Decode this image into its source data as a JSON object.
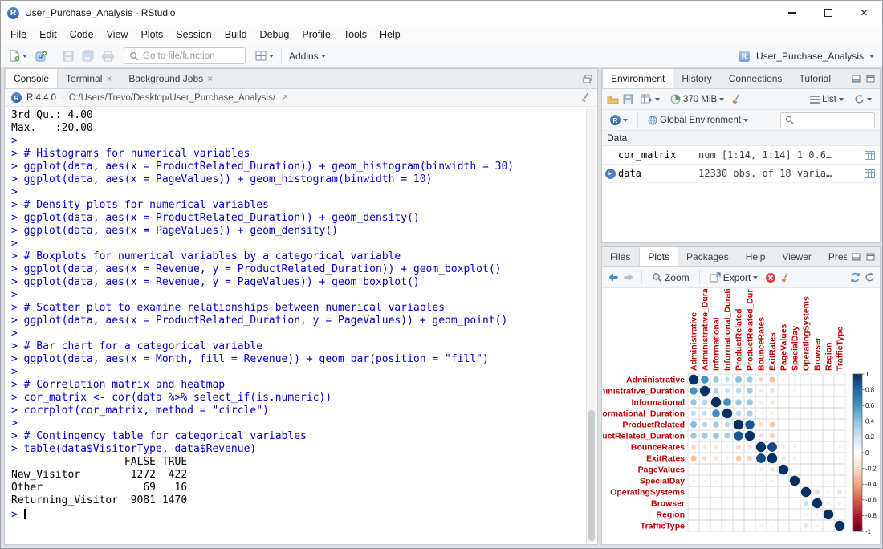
{
  "window": {
    "title": "User_Purchase_Analysis - RStudio"
  },
  "menubar": {
    "items": [
      "File",
      "Edit",
      "Code",
      "View",
      "Plots",
      "Session",
      "Build",
      "Debug",
      "Profile",
      "Tools",
      "Help"
    ]
  },
  "toolbar": {
    "goto_placeholder": "Go to file/function",
    "addins_label": "Addins",
    "project_label": "User_Purchase_Analysis"
  },
  "console": {
    "tabs": [
      {
        "label": "Console",
        "active": true,
        "closable": false
      },
      {
        "label": "Terminal",
        "active": false,
        "closable": true
      },
      {
        "label": "Background Jobs",
        "active": false,
        "closable": true
      }
    ],
    "r_version": "R 4.4.0",
    "separator": "·",
    "working_dir": "C:/Users/Trevo/Desktop/User_Purchase_Analysis/",
    "lines": [
      {
        "t": "3rd Qu.: 4.00",
        "k": "out"
      },
      {
        "t": "Max.   :20.00",
        "k": "out"
      },
      {
        "t": "> ",
        "k": "in"
      },
      {
        "t": "> # Histograms for numerical variables",
        "k": "in"
      },
      {
        "t": "> ggplot(data, aes(x = ProductRelated_Duration)) + geom_histogram(binwidth = 30)",
        "k": "in"
      },
      {
        "t": "> ggplot(data, aes(x = PageValues)) + geom_histogram(binwidth = 10)",
        "k": "in"
      },
      {
        "t": "> ",
        "k": "in"
      },
      {
        "t": "> # Density plots for numerical variables",
        "k": "in"
      },
      {
        "t": "> ggplot(data, aes(x = ProductRelated_Duration)) + geom_density()",
        "k": "in"
      },
      {
        "t": "> ggplot(data, aes(x = PageValues)) + geom_density()",
        "k": "in"
      },
      {
        "t": "> ",
        "k": "in"
      },
      {
        "t": "> # Boxplots for numerical variables by a categorical variable",
        "k": "in"
      },
      {
        "t": "> ggplot(data, aes(x = Revenue, y = ProductRelated_Duration)) + geom_boxplot()",
        "k": "in"
      },
      {
        "t": "> ggplot(data, aes(x = Revenue, y = PageValues)) + geom_boxplot()",
        "k": "in"
      },
      {
        "t": "> ",
        "k": "in"
      },
      {
        "t": "> # Scatter plot to examine relationships between numerical variables",
        "k": "in"
      },
      {
        "t": "> ggplot(data, aes(x = ProductRelated_Duration, y = PageValues)) + geom_point()",
        "k": "in"
      },
      {
        "t": "> ",
        "k": "in"
      },
      {
        "t": "> # Bar chart for a categorical variable",
        "k": "in"
      },
      {
        "t": "> ggplot(data, aes(x = Month, fill = Revenue)) + geom_bar(position = \"fill\")",
        "k": "in"
      },
      {
        "t": "> ",
        "k": "in"
      },
      {
        "t": "> # Correlation matrix and heatmap",
        "k": "in"
      },
      {
        "t": "> cor_matrix <- cor(data %>% select_if(is.numeric))",
        "k": "in"
      },
      {
        "t": "> corrplot(cor_matrix, method = \"circle\")",
        "k": "in"
      },
      {
        "t": "> ",
        "k": "in"
      },
      {
        "t": "> # Contingency table for categorical variables",
        "k": "in"
      },
      {
        "t": "> table(data$VisitorType, data$Revenue)",
        "k": "in"
      },
      {
        "t": "",
        "k": "out"
      },
      {
        "t": "                  FALSE TRUE",
        "k": "out"
      },
      {
        "t": "New_Visitor        1272  422",
        "k": "out"
      },
      {
        "t": "Other                69   16",
        "k": "out"
      },
      {
        "t": "Returning_Visitor  9081 1470",
        "k": "out"
      },
      {
        "t": "> ",
        "k": "in",
        "cursor": true
      }
    ]
  },
  "environment": {
    "tabs": [
      "Environment",
      "History",
      "Connections",
      "Tutorial"
    ],
    "active_tab": "Environment",
    "memory_label": "370 MiB",
    "language_label": "R",
    "scope_label": "Global Environment",
    "list_label": "List",
    "section_label": "Data",
    "objects": [
      {
        "name": "cor_matrix",
        "value": "num [1:14, 1:14] 1 0.6…",
        "expandable": false
      },
      {
        "name": "data",
        "value": "12330 obs. of 18 varia…",
        "expandable": true
      }
    ]
  },
  "plots": {
    "tabs": [
      "Files",
      "Plots",
      "Packages",
      "Help",
      "Viewer",
      "Prese"
    ],
    "active_tab": "Plots",
    "zoom_label": "Zoom",
    "export_label": "Export"
  },
  "chart_data": {
    "type": "heatmap",
    "subtype": "correlation-circle-matrix",
    "title": "corrplot(cor_matrix, method = \"circle\")",
    "variables": [
      "Administrative",
      "Administrative_Duration",
      "Informational",
      "Informational_Duration",
      "ProductRelated",
      "ProductRelated_Duration",
      "BounceRates",
      "ExitRates",
      "PageValues",
      "SpecialDay",
      "OperatingSystems",
      "Browser",
      "Region",
      "TrafficType"
    ],
    "matrix": [
      [
        1,
        0.6,
        0.38,
        0.26,
        0.43,
        0.37,
        -0.22,
        -0.32,
        0.1,
        -0.09,
        -0.01,
        -0.03,
        -0.01,
        -0.03
      ],
      [
        0.6,
        1,
        0.3,
        0.24,
        0.29,
        0.36,
        -0.14,
        -0.21,
        0.07,
        -0.07,
        0,
        -0.02,
        0,
        -0.01
      ],
      [
        0.38,
        0.3,
        1,
        0.62,
        0.37,
        0.39,
        -0.12,
        -0.16,
        0.05,
        -0.05,
        -0.01,
        -0.04,
        -0.03,
        -0.03
      ],
      [
        0.26,
        0.24,
        0.62,
        1,
        0.28,
        0.35,
        -0.07,
        -0.11,
        0.03,
        -0.03,
        -0.01,
        -0.02,
        -0.03,
        -0.02
      ],
      [
        0.43,
        0.29,
        0.37,
        0.28,
        1,
        0.86,
        -0.2,
        -0.29,
        0.06,
        -0.02,
        0,
        -0.01,
        -0.04,
        -0.04
      ],
      [
        0.37,
        0.36,
        0.39,
        0.35,
        0.86,
        1,
        -0.18,
        -0.25,
        0.05,
        -0.04,
        0,
        0,
        -0.03,
        -0.04
      ],
      [
        -0.22,
        -0.14,
        -0.12,
        -0.07,
        -0.2,
        -0.18,
        1,
        0.91,
        -0.12,
        0.07,
        0.02,
        -0.02,
        -0.01,
        0.08
      ],
      [
        -0.32,
        -0.21,
        -0.16,
        -0.11,
        -0.29,
        -0.25,
        0.91,
        1,
        -0.17,
        0.1,
        0.02,
        -0.01,
        0,
        0.08
      ],
      [
        0.1,
        0.07,
        0.05,
        0.03,
        0.06,
        0.05,
        -0.12,
        -0.17,
        1,
        -0.06,
        0.02,
        0.05,
        0.01,
        0.01
      ],
      [
        -0.09,
        -0.07,
        -0.05,
        -0.03,
        -0.02,
        -0.04,
        0.07,
        0.1,
        -0.06,
        1,
        0.01,
        0,
        -0.02,
        0.05
      ],
      [
        -0.01,
        0,
        -0.01,
        -0.01,
        0,
        0,
        0.02,
        0.02,
        0.02,
        0.01,
        1,
        0.22,
        0.08,
        0.19
      ],
      [
        -0.03,
        -0.02,
        -0.04,
        -0.02,
        -0.01,
        0,
        -0.02,
        -0.01,
        0.05,
        0,
        0.22,
        1,
        0.1,
        0.11
      ],
      [
        -0.01,
        0,
        -0.03,
        -0.03,
        -0.04,
        -0.03,
        -0.01,
        0,
        0.01,
        -0.02,
        0.08,
        0.1,
        1,
        0.05
      ],
      [
        -0.03,
        -0.01,
        -0.03,
        -0.02,
        -0.04,
        -0.04,
        0.08,
        0.08,
        0.01,
        0.05,
        0.19,
        0.11,
        0.05,
        1
      ]
    ],
    "value_range": [
      -1,
      1
    ],
    "legend_ticks": [
      "1",
      "0.8",
      "0.6",
      "0.4",
      "0.2",
      "0",
      "-0.2",
      "-0.4",
      "-0.6",
      "-0.8",
      "-1"
    ],
    "legend_position": "right",
    "label_color": "#c40000",
    "palette": [
      "#67001F",
      "#B2182B",
      "#D6604D",
      "#F4A582",
      "#FDDBC7",
      "#FFFFFF",
      "#D1E5F0",
      "#92C5DE",
      "#4393C3",
      "#2166AC",
      "#053061"
    ]
  }
}
